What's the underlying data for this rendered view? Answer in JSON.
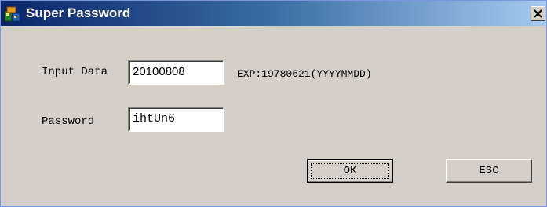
{
  "window": {
    "title": "Super Password",
    "close_glyph": "✕"
  },
  "icons": {
    "app": "app-icon",
    "close": "close-icon"
  },
  "colors": {
    "titlebar_start": "#0a246a",
    "titlebar_end": "#a6caf0",
    "dialog_bg": "#d4d0c8"
  },
  "form": {
    "input_data_label": "Input Data",
    "input_data_value": "20100808",
    "example_hint": "EXP:19780621(YYYYMMDD)",
    "password_label": "Password",
    "password_value": "ihtUn6"
  },
  "buttons": {
    "ok_label": "OK",
    "esc_label": "ESC"
  }
}
